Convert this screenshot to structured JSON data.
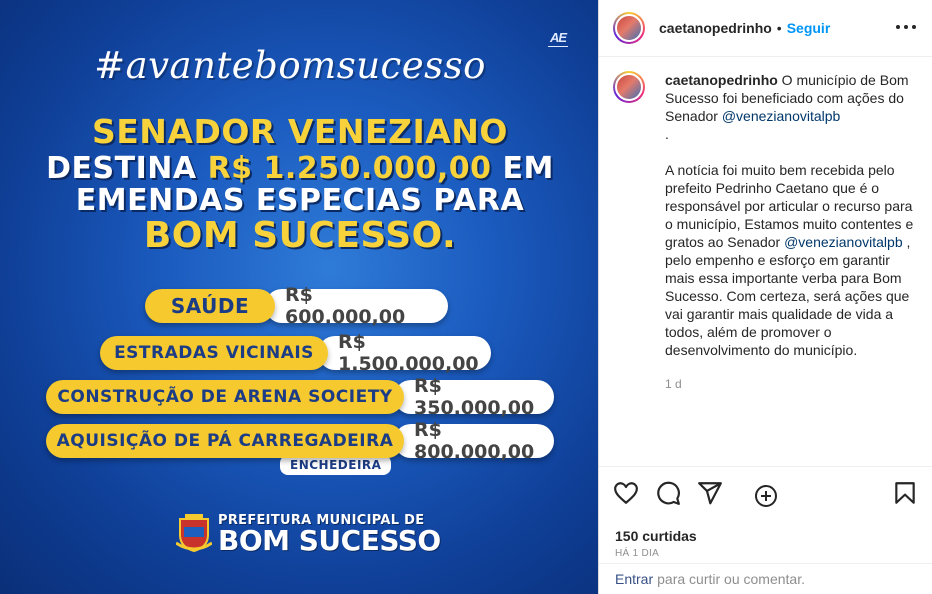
{
  "post_image": {
    "logo": "AE",
    "hashtag": "#avantebomsucesso",
    "headline": {
      "line1": "SENADOR VENEZIANO",
      "line2_prefix": "DESTINA ",
      "line2_money": "R$ 1.250.000,00",
      "line2_suffix": " EM",
      "line3": "EMENDAS ESPECIAS PARA",
      "line4": "BOM SUCESSO."
    },
    "items": [
      {
        "label": "SAÚDE",
        "value": "R$ 600.000,00"
      },
      {
        "label": "ESTRADAS VICINAIS",
        "value": "R$ 1.500.000,00"
      },
      {
        "label": "CONSTRUÇÃO DE ARENA SOCIETY",
        "value": "R$ 350.000,00"
      },
      {
        "label": "AQUISIÇÃO DE PÁ CARREGADEIRA",
        "value": "R$ 800.000,00"
      }
    ],
    "sub_label": "ENCHEDEIRA",
    "footer_top": "PREFEITURA MUNICIPAL DE",
    "footer_bottom": "BOM SUCESSO"
  },
  "header": {
    "username": "caetanopedrinho",
    "separator": "•",
    "follow_label": "Seguir"
  },
  "caption": {
    "username": "caetanopedrinho",
    "p1_text": " O município de Bom Sucesso foi beneficiado com ações do Senador ",
    "p1_mention": "@venezianovitalpb",
    "p1_end": " .",
    "p2_text": "A notícia foi muito bem recebida pelo prefeito Pedrinho Caetano que é o responsável por articular o recurso para o município, Estamos muito contentes e gratos ao Senador ",
    "p2_mention": "@venezianovitalpb",
    "p2_end": " , pelo empenho e esforço em garantir mais essa importante verba para Bom Sucesso. Com certeza, será ações que vai garantir mais qualidade de vida a todos, além de promover o desenvolvimento do município.",
    "time_ago": "1 d"
  },
  "actions": {
    "likes": "150 curtidas",
    "date": "HÁ 1 DIA"
  },
  "comment": {
    "link_label": "Entrar",
    "rest_label": "para curtir ou comentar."
  },
  "colors": {
    "brand_blue": "#0095f6",
    "poster_blue": "#1b5bbf",
    "poster_yellow": "#f6c92e"
  }
}
